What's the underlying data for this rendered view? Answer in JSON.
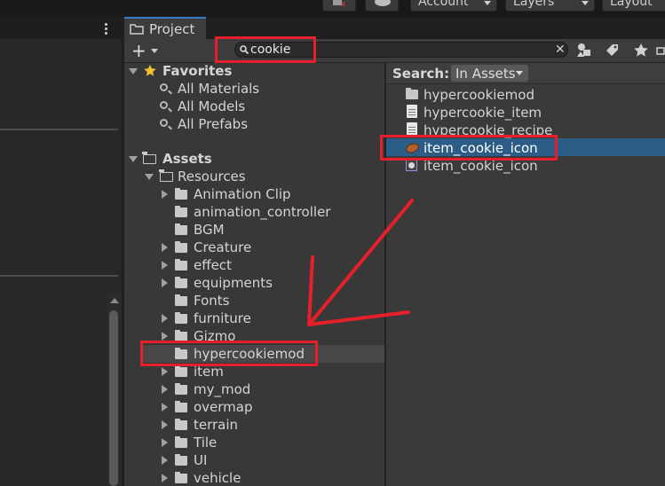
{
  "toolbar": {
    "account_label": "Account",
    "layers_label": "Layers",
    "layout_label": "Layout"
  },
  "project": {
    "tab_label": "Project",
    "search_value": "cookie"
  },
  "tree": {
    "favorites_label": "Favorites",
    "favorites": [
      "All Materials",
      "All Models",
      "All Prefabs"
    ],
    "assets_label": "Assets",
    "resources_label": "Resources",
    "folders": [
      {
        "label": "Animation Clip",
        "expandable": true
      },
      {
        "label": "animation_controller",
        "expandable": false
      },
      {
        "label": "BGM",
        "expandable": false
      },
      {
        "label": "Creature",
        "expandable": true
      },
      {
        "label": "effect",
        "expandable": true
      },
      {
        "label": "equipments",
        "expandable": true
      },
      {
        "label": "Fonts",
        "expandable": false
      },
      {
        "label": "furniture",
        "expandable": true
      },
      {
        "label": "Gizmo",
        "expandable": true
      },
      {
        "label": "hypercookiemod",
        "expandable": false
      },
      {
        "label": "item",
        "expandable": true
      },
      {
        "label": "my_mod",
        "expandable": true
      },
      {
        "label": "overmap",
        "expandable": true
      },
      {
        "label": "terrain",
        "expandable": true
      },
      {
        "label": "Tile",
        "expandable": true
      },
      {
        "label": "UI",
        "expandable": true
      },
      {
        "label": "vehicle",
        "expandable": true
      }
    ]
  },
  "results": {
    "search_label": "Search:",
    "scope_label": "In Assets",
    "items": [
      {
        "label": "hypercookiemod",
        "icon": "folder-icon"
      },
      {
        "label": "hypercookie_item",
        "icon": "script-file-icon"
      },
      {
        "label": "hypercookie_recipe",
        "icon": "script-file-icon"
      },
      {
        "label": "item_cookie_icon",
        "icon": "cookie-texture-icon"
      },
      {
        "label": "item_cookie_icon",
        "icon": "sprite-icon"
      }
    ]
  },
  "colors": {
    "annotation_red": "#e5202b",
    "selection_blue": "#2c5d87"
  }
}
